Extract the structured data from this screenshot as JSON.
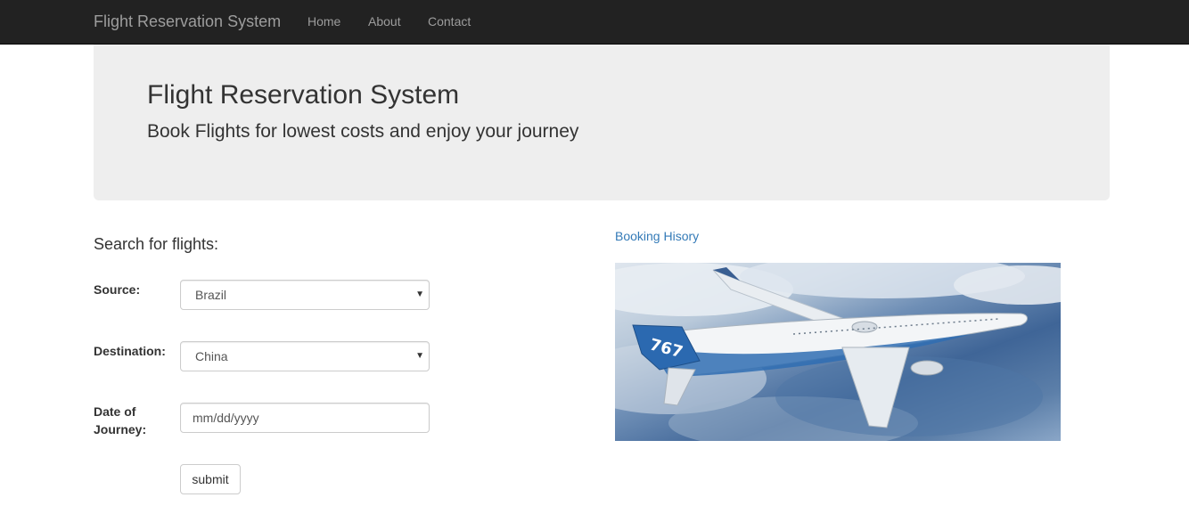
{
  "navbar": {
    "brand": "Flight Reservation System",
    "links": [
      "Home",
      "About",
      "Contact"
    ]
  },
  "jumbotron": {
    "title": "Flight Reservation System",
    "subtitle": "Book Flights for lowest costs and enjoy your journey"
  },
  "search": {
    "heading": "Search for flights:",
    "source_label": "Source:",
    "source_value": "Brazil",
    "destination_label": "Destination:",
    "destination_value": "China",
    "date_label": "Date of Journey:",
    "date_placeholder": "mm/dd/yyyy",
    "submit_label": "submit"
  },
  "sidebar": {
    "history_link": "Booking Hisory",
    "image_icon": "airplane-photo",
    "tail_text": "767"
  },
  "colors": {
    "navbar_bg": "#222222",
    "navbar_text": "#9d9d9d",
    "jumbotron_bg": "#eeeeee",
    "link": "#337ab7"
  }
}
